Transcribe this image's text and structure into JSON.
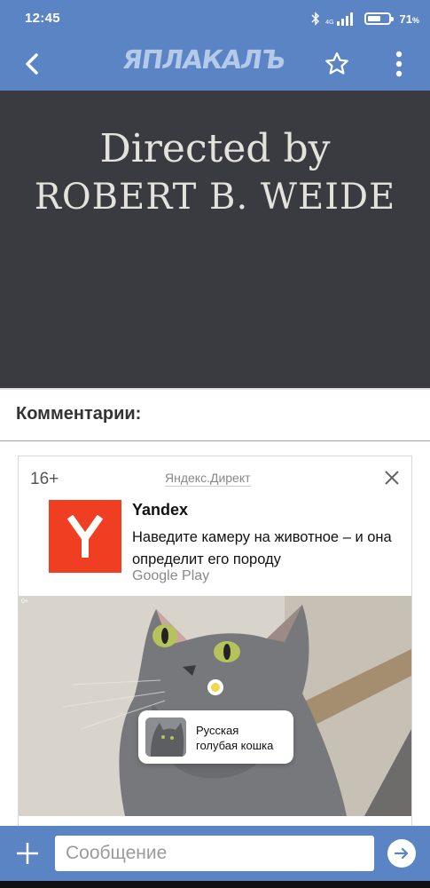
{
  "status_bar": {
    "time": "12:45",
    "network_label": "4G",
    "battery_percent": "71",
    "battery_unit": "%",
    "battery_level": 0.71,
    "icons": [
      "bluetooth-icon",
      "signal-icon",
      "battery-icon"
    ]
  },
  "app_bar": {
    "logo_text": "ЯПЛАКАЛЪ",
    "icons": [
      "back-arrow-icon",
      "star-icon",
      "more-vertical-icon"
    ],
    "background": "#5b84c4"
  },
  "video": {
    "line1": "Directed by",
    "line2": "ROBERT B. WEIDE"
  },
  "comments": {
    "title": "Комментарии:"
  },
  "ad": {
    "age_rating": "16+",
    "source": "Яндекс.Директ",
    "title": "Yandex",
    "text": "Наведите камеру на животное – и она определит его породу",
    "store": "Google Play",
    "image_age": "0+",
    "tag_text_line1": "Русская",
    "tag_text_line2": "голубая кошка",
    "brand_color": "#f03e22"
  },
  "composer": {
    "placeholder": "Сообщение",
    "icons": [
      "plus-icon",
      "send-arrow-icon"
    ]
  }
}
